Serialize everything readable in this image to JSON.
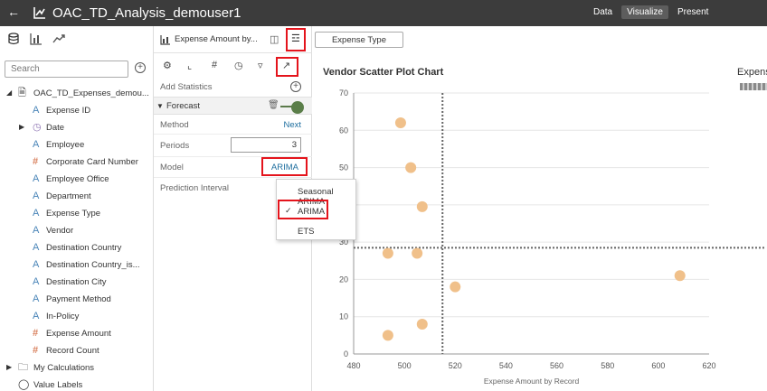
{
  "topbar": {
    "title": "OAC_TD_Analysis_demouser1",
    "modes": [
      "Data",
      "Visualize",
      "Present"
    ],
    "active_mode": "Visualize"
  },
  "data_panel": {
    "search_placeholder": "Search",
    "dataset": "OAC_TD_Expenses_demou...",
    "fields": [
      {
        "label": "Expense ID",
        "type": "attribute"
      },
      {
        "label": "Date",
        "type": "date"
      },
      {
        "label": "Employee",
        "type": "attribute"
      },
      {
        "label": "Corporate Card Number",
        "type": "measure"
      },
      {
        "label": "Employee Office",
        "type": "attribute"
      },
      {
        "label": "Department",
        "type": "attribute"
      },
      {
        "label": "Expense Type",
        "type": "attribute"
      },
      {
        "label": "Vendor",
        "type": "attribute"
      },
      {
        "label": "Destination Country",
        "type": "attribute"
      },
      {
        "label": "Destination Country_is...",
        "type": "attribute"
      },
      {
        "label": "Destination City",
        "type": "attribute"
      },
      {
        "label": "Payment Method",
        "type": "attribute"
      },
      {
        "label": "In-Policy",
        "type": "attribute"
      },
      {
        "label": "Expense Amount",
        "type": "measure"
      },
      {
        "label": "Record Count",
        "type": "measure"
      }
    ],
    "my_calculations": "My Calculations",
    "value_labels": "Value Labels"
  },
  "grammar_panel": {
    "viz_title": "Expense Amount by...",
    "add_statistics": "Add Statistics",
    "forecast_label": "Forecast",
    "forecast_enabled": true,
    "method_label": "Method",
    "method_value": "Next",
    "periods_label": "Periods",
    "periods_value": "3",
    "model_label": "Model",
    "model_value": "ARIMA",
    "prediction_interval_label": "Prediction Interval"
  },
  "model_dropdown": {
    "options": [
      "Seasonal ARIMA",
      "ARIMA",
      "ETS"
    ],
    "selected": "ARIMA"
  },
  "filter_pill": "Expense Type",
  "legend_title": "Expens",
  "colors": {
    "topbar": "#3c3c3c",
    "highlight": "#e4141c",
    "point": "#f0c08a",
    "toggle": "#5a7e49",
    "link": "#1f6f9f"
  },
  "chart_data": {
    "type": "scatter",
    "title": "Vendor Scatter Plot Chart",
    "xlabel": "Expense Amount by Record",
    "ylabel": "",
    "xlim": [
      480,
      620
    ],
    "ylim": [
      0,
      70
    ],
    "xticks": [
      480,
      500,
      520,
      540,
      560,
      580,
      600,
      620
    ],
    "yticks": [
      0,
      10,
      20,
      30,
      40,
      50,
      60,
      70
    ],
    "reference_lines": {
      "x": 515,
      "y": 28.5
    },
    "points": [
      {
        "x": 498.5,
        "y": 62
      },
      {
        "x": 502.5,
        "y": 50
      },
      {
        "x": 507.0,
        "y": 39.5
      },
      {
        "x": 493.5,
        "y": 27
      },
      {
        "x": 505.0,
        "y": 27
      },
      {
        "x": 520.0,
        "y": 18
      },
      {
        "x": 507.0,
        "y": 8
      },
      {
        "x": 493.5,
        "y": 5
      },
      {
        "x": 608.5,
        "y": 21
      }
    ]
  }
}
